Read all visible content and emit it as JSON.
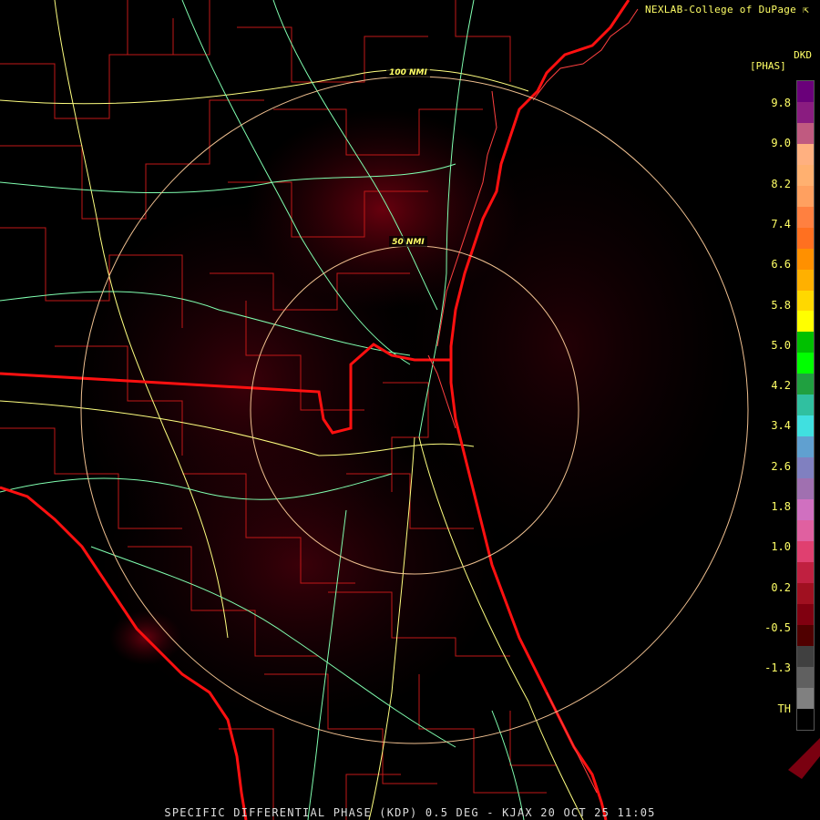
{
  "credit": "NEXLAB-College of DuPage",
  "product": "SPECIFIC DIFFERENTIAL PHASE (KDP) 0.5 DEG - KJAX 20 OCT 25 11:05",
  "legend": {
    "unit_code": "DKD",
    "unit_name": "[PHAS]",
    "tick_labels": [
      "9.8",
      "9.0",
      "8.2",
      "7.4",
      "6.6",
      "5.8",
      "5.0",
      "4.2",
      "3.4",
      "2.6",
      "1.8",
      "1.0",
      "0.2",
      "-0.5",
      "-1.3",
      "TH"
    ],
    "colors": [
      "#6a007a",
      "#8a1c80",
      "#c05a80",
      "#ffb080",
      "#ffb070",
      "#ffa060",
      "#ff8040",
      "#ff7020",
      "#ff9000",
      "#ffb000",
      "#ffd800",
      "#ffff00",
      "#00c000",
      "#00ff00",
      "#20a040",
      "#30c0a0",
      "#40e0e0",
      "#60a0d0",
      "#8080c0",
      "#a070b0",
      "#d070c0",
      "#e060a0",
      "#e04070",
      "#c02040",
      "#a01020",
      "#800010",
      "#500000",
      "#404040",
      "#606060",
      "#808080",
      "#000000"
    ]
  },
  "range_rings": [
    {
      "label": "50 NMI"
    },
    {
      "label": "100 NMI"
    }
  ]
}
